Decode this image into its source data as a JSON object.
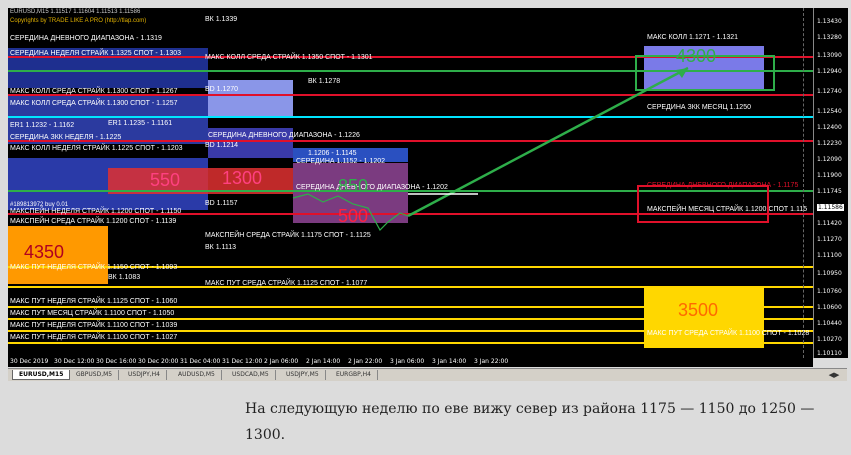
{
  "chart": {
    "header_symbol": "EURUSD,M15  1.11517 1.11604 1.11513 1.11586",
    "copyright": "Copyrights by TRADE LIKE A PRO (http://tlap.com)",
    "labels": {
      "mid_day": "СЕРЕДИНА ДНЕВНОГО ДИАПАЗОНА - 1.1319",
      "mid_week": "СЕРЕДИНА НЕДЕЛЯ СТРАЙК 1.1325 СПОТ - 1.1303",
      "max_call_wed": "МАКС КОЛЛ СРЕДА  СТРАЙК 1.1350 СПОТ - 1.1301",
      "max_call_r": "МАКС КОЛЛ 1.1271 - 1.1321",
      "mid_zkk_month": "СЕРЕДИНА ЗКК МЕСЯЦ  1.1250",
      "mid_day_r": "СЕРЕДИНА ДНЕВНОГО ДИАПАЗОНА - 1.1175",
      "maxpain_month_r": "МАКСПЕЙН МЕСЯЦ  СТРАЙК 1.1200 СПОТ 1.115",
      "vk_1339": "ВК 1.1339",
      "vk_1278": "ВК 1.1278",
      "vd_1270": "ВD 1.1270",
      "max_call_1": "МАКС КОЛЛ СРЕДА  СТРАЙК 1.1300 СПОТ - 1.1267",
      "max_call_2": "МАКС КОЛЛ СРЕДА  СТРАЙК 1.1300 СПОТ - 1.1257",
      "er1": "ER1 1.1232 - 1.1162",
      "er1b": "ER1 1.1235 - 1.1161",
      "mid_day2": "СЕРЕДИНА ДНЕВНОГО ДИАПАЗОНА - 1.1226",
      "mid_zkk_week": "СЕРЕДИНА ЗКК НЕДЕЛЯ - 1.1225",
      "max_call_week": "МАКС КОЛЛ НЕДЕЛЯ  СТРАЙК 1.1225 СПОТ - 1.1203",
      "vd_1214": "ВD 1.1214",
      "strike_1206": "1.1206 - 1.1145",
      "mid_1152": "СЕРЕДИНА 1.1152 - 1.1202",
      "mid_day3": "СЕРЕДИНА ДНЕВНОГО ДИАПАЗОНА - 1.1202",
      "vd_1157": "ВD 1.1157",
      "maxpain_week": "МАКСПЕЙН НЕДЕЛЯ  СТРАЙК 1.1200 СПОТ - 1.1150",
      "maxpain_wed": "МАКСПЕЙН СРЕДА  СТРАЙК 1.1200 СПОТ - 1.1139",
      "buy_order": "#189813972 buy 0.01",
      "maxpain_wed2": "МАКСПЕЙН СРЕДА  СТРАЙК 1.1175 СПОТ - 1.1125",
      "vk_1113": "ВК 1.1113",
      "max_put_week_0": "МАКС ПУТ НЕДЕЛЯ  СТРАЙК 1.1150 СПОТ - 1.1093",
      "vk_1083": "ВК 1.1083",
      "max_put_wed": "МАКС ПУТ СРЕДА  СТРАЙК 1.1125 СПОТ - 1.1077",
      "max_put_week": "МАКС ПУТ НЕДЕЛЯ  СТРАЙК 1.1125 СПОТ - 1.1060",
      "max_put_month": "МАКС ПУТ МЕСЯЦ  СТРАЙК 1.1100 СПОТ - 1.1050",
      "max_put_week2": "МАКС ПУТ НЕДЕЛЯ  СТРАЙК 1.1100 СПОТ - 1.1039",
      "max_put_week3": "МАКС ПУТ НЕДЕЛЯ  СТРАЙК 1.1100 СПОТ - 1.1027",
      "max_put_wed_r": "МАКС ПУТ СРЕДА  СТРАЙК 1.1100 СПОТ - 1.1028"
    },
    "big_numbers": {
      "n4350": "4350",
      "n1300": "1300",
      "n550": "550",
      "n3500": "3500",
      "n850": "850",
      "n500": "500",
      "n4300": "4300"
    },
    "colors": {
      "green": "#2eae4a",
      "red": "#e0102a",
      "blue_band": "#4169e1",
      "orange": "#ff8c00",
      "yellow": "#ffd700",
      "cyan": "#00e5ff"
    }
  },
  "yaxis": [
    "1.13430",
    "1.13280",
    "1.13090",
    "1.12940",
    "1.12740",
    "1.12540",
    "1.12400",
    "1.12230",
    "1.12090",
    "1.11900",
    "1.11745",
    "1.11586",
    "1.11420",
    "1.11270",
    "1.11100",
    "1.10950",
    "1.10760",
    "1.10600",
    "1.10440",
    "1.10270",
    "1.10110"
  ],
  "xaxis": [
    "30 Dec 2019",
    "30 Dec 12:00",
    "30 Dec 16:00",
    "30 Dec 20:00",
    "31 Dec 04:00",
    "31 Dec 12:00",
    "2 Jan 06:00",
    "2 Jan 14:00",
    "2 Jan 22:00",
    "3 Jan 06:00",
    "3 Jan 14:00",
    "3 Jan 22:00"
  ],
  "tabs": [
    "EURUSD,M15",
    "GBPUSD,M5",
    "USDJPY,H4",
    "AUDUSD,M5",
    "USDCAD,M5",
    "USDJPY,M5",
    "EURGBP,H4"
  ],
  "caption": "На следующую неделю по еве вижу север из района 1175 — 1150 до 1250 — 1300."
}
